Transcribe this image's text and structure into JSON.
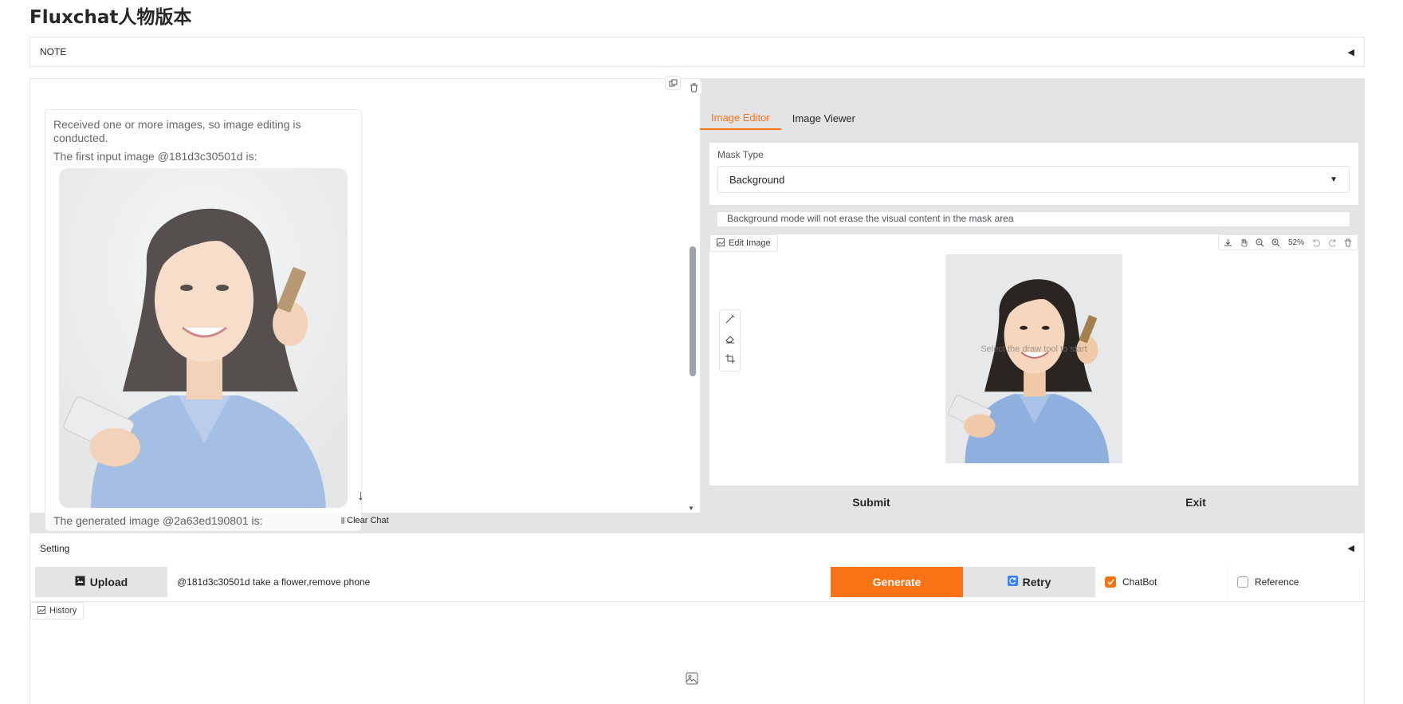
{
  "app": {
    "title": "Fluxchat人物版本"
  },
  "note": {
    "label": "NOTE",
    "arrow": "◀"
  },
  "chat": {
    "message_line1": "Received one or more images, so image editing is conducted.",
    "message_line2": "The first input image @181d3c30501d is:",
    "message_cutoff": "The generated image @2a63ed190801 is:",
    "clear_label": "Clear Chat"
  },
  "editor_panel": {
    "tabs": [
      "Image Editor",
      "Image Viewer"
    ],
    "active_tab": "Image Editor",
    "mask_type_label": "Mask Type",
    "mask_type_value": "Background",
    "mask_info": "Background mode will not erase the visual content in the mask area",
    "edit_image_label": "Edit Image",
    "zoom": "52%",
    "canvas_hint": "Select the draw tool to start",
    "submit_label": "Submit",
    "exit_label": "Exit"
  },
  "setting": {
    "label": "Setting",
    "arrow": "◀"
  },
  "controls": {
    "upload_label": "Upload",
    "prompt_value": "@181d3c30501d take a flower,remove phone",
    "generate_label": "Generate",
    "retry_label": "Retry",
    "chatbot_label": "ChatBot",
    "chatbot_checked": true,
    "reference_label": "Reference",
    "reference_checked": false
  },
  "history": {
    "label": "History"
  },
  "colors": {
    "accent": "#f97316",
    "border": "#e4e4e7",
    "panel_bg": "#e4e4e7"
  },
  "icons": [
    "copy-icon",
    "trash-icon",
    "download-icon",
    "pan-icon",
    "zoom-out-icon",
    "zoom-in-icon",
    "undo-icon",
    "redo-icon",
    "brush-icon",
    "eraser-icon",
    "crop-icon",
    "image-icon",
    "upload-icon",
    "retry-icon",
    "chevron-down-icon",
    "arrow-down-icon",
    "broom-icon"
  ]
}
